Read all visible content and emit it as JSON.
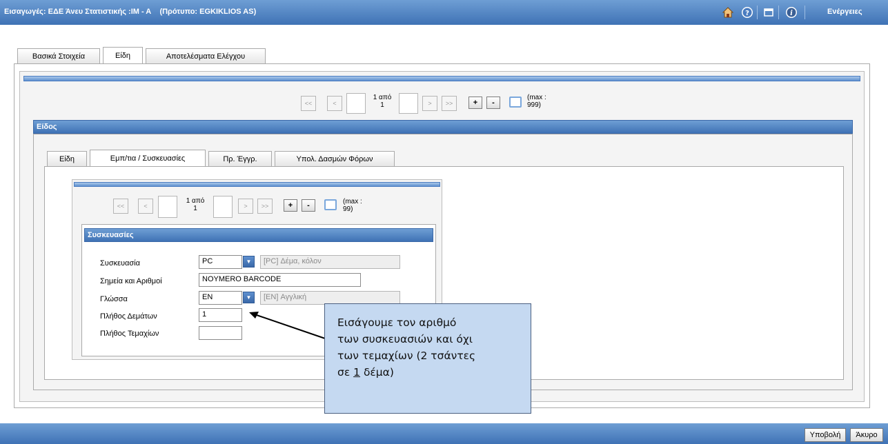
{
  "header": {
    "title": "Εισαγωγές: ΕΔΕ Άνευ Στατιστικής :ΙΜ - Α    (Πρότυπο: EGKIKLIOS AS)",
    "actions_label": "Ενέργειες"
  },
  "main_tabs": [
    "Βασικά Στοιχεία",
    "Είδη",
    "Αποτελέσματα Ελέγχου"
  ],
  "pager_outer": {
    "current": "1 από",
    "total": "1",
    "max_line1": "(max :",
    "max_line2": "999)",
    "first": "<<",
    "prev": "<",
    "next": ">",
    "last": ">>",
    "add": "+",
    "remove": "-"
  },
  "item_section": {
    "title": "Είδος"
  },
  "item_tabs": [
    "Είδη",
    "Εμπ/τια / Συσκευασίες",
    "Πρ. Έγγρ.",
    "Υπολ. Δασμών Φόρων"
  ],
  "pager_inner": {
    "current": "1 από",
    "total": "1",
    "max_line1": "(max :",
    "max_line2": "99)",
    "first": "<<",
    "prev": "<",
    "next": ">",
    "last": ">>",
    "add": "+",
    "remove": "-"
  },
  "packages": {
    "title": "Συσκευασίες",
    "package_label": "Συσκευασία",
    "package_code": "PC",
    "package_desc": "[PC] Δέμα, κόλον",
    "marks_label": "Σημεία και Αριθμοί",
    "marks_value": "NOYMERO BARCODE",
    "language_label": "Γλώσσα",
    "language_code": "EN",
    "language_desc": "[EN] Αγγλική",
    "packages_count_label": "Πλήθος Δεμάτων",
    "packages_count_value": "1",
    "pieces_count_label": "Πλήθος Τεμαχίων",
    "pieces_count_value": ""
  },
  "callout": {
    "line1": "Εισάγουμε τον αριθμό",
    "line2": "των συσκευασιών και όχι",
    "line3": "των τεμαχίων (2 τσάντες",
    "line4_pre": "σε ",
    "line4_num": "1",
    "line4_post": " δέμα)"
  },
  "footer": {
    "submit_label": "Υποβολή",
    "cancel_label": "Άκυρο"
  },
  "colors": {
    "header_blue": "#4a7cc0",
    "callout_bg": "#c5d9f1"
  },
  "icons": [
    "home-icon",
    "help-icon",
    "window-icon",
    "info-icon",
    "dropdown-arrow-icon",
    "arrow-icon"
  ]
}
